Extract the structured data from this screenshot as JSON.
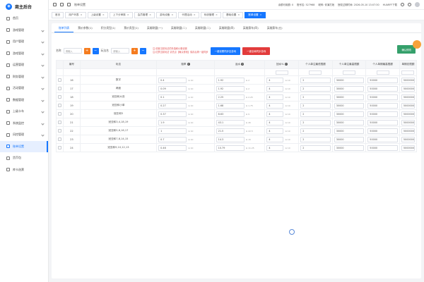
{
  "app": {
    "title": "商主后台"
  },
  "sidebar": {
    "items": [
      {
        "label": "首页",
        "active": false
      },
      {
        "label": "游戏管理",
        "active": false
      },
      {
        "label": "用户管理",
        "active": false
      },
      {
        "label": "游戏管理",
        "active": false
      },
      {
        "label": "运营管理",
        "active": false
      },
      {
        "label": "财务管理",
        "active": false
      },
      {
        "label": "活动管理",
        "active": false
      },
      {
        "label": "数据管理",
        "active": false
      },
      {
        "label": "上级卡车",
        "active": false
      },
      {
        "label": "系统监控",
        "active": false
      },
      {
        "label": "风控管理",
        "active": false
      },
      {
        "label": "账单设置",
        "active": true
      },
      {
        "label": "货币包",
        "active": false
      },
      {
        "label": "库卡选票",
        "active": false
      }
    ]
  },
  "topbar": {
    "breadcrumb": "账单设置",
    "info1": "余额可用额: 0",
    "info2": "账号名: 527968",
    "info3": "昵称: 你演打她",
    "info4": "授权过期时间: 2026-05-10 13:07:30",
    "info5": "HUARFF下载"
  },
  "tags": [
    {
      "label": "首页",
      "active": false
    },
    {
      "label": "用户列表",
      "active": false
    },
    {
      "label": "上级设置",
      "active": false
    },
    {
      "label": "上下分审核",
      "active": false
    },
    {
      "label": "会员管理",
      "active": false
    },
    {
      "label": "游戏设备",
      "active": false
    },
    {
      "label": "代理活动",
      "active": false
    },
    {
      "label": "系统管理",
      "active": false
    },
    {
      "label": "基础设置",
      "active": false
    },
    {
      "label": "账单设置",
      "active": true
    }
  ],
  "subtabs": [
    {
      "label": "账单列表",
      "active": true
    },
    {
      "label": "票价参数(1)",
      "active": false
    },
    {
      "label": "积分类型(1)",
      "active": false
    },
    {
      "label": "票价类型(1)",
      "active": false
    },
    {
      "label": "英雄联盟(一)",
      "active": false
    },
    {
      "label": "英雄联盟(二)",
      "active": false
    },
    {
      "label": "英雄联盟(二)",
      "active": false
    },
    {
      "label": "英雄联盟(四)",
      "active": false
    },
    {
      "label": "英雄赛车(四)",
      "active": false
    },
    {
      "label": "英雄赛车(五)",
      "active": false
    }
  ],
  "filter": {
    "label1": "名称",
    "placeholder1": "请输入",
    "label2": "玩法名",
    "placeholder2": "请输入",
    "tip1": "注:设置当前玩法的负值和价格设置",
    "tip2": "注:红票当前玩法 请先点【确认修改】保存后再一键同步",
    "btn_sync_prefix": "一键设置同步至游戏",
    "btn_sync_all": "一键全局同步游戏",
    "btn_confirm": "确认修改"
  },
  "table": {
    "headers": {
      "idx": "编号",
      "name": "玩法",
      "odds": "赔率",
      "rebate": "返水",
      "rate": "回水%",
      "single_min": "个人单注最低限额",
      "single_max": "个人单注最高限额",
      "total_max": "个人单期最高限额",
      "total": "单期总限额"
    },
    "rows": [
      {
        "id": "16",
        "name": "数字",
        "odds": "0.4",
        "odds_range": "≤ 10",
        "rebate": "1.92",
        "rebate_range": "≤ 2",
        "rate": "4",
        "rate_range": "≤ 10",
        "min": "2",
        "max": "30000",
        "tmax": "50000",
        "total": "5000000"
      },
      {
        "id": "17",
        "name": "两面",
        "odds": "0.09",
        "odds_range": "≤ 10",
        "rebate": "1.92",
        "rebate_range": "≤ 2",
        "rate": "4",
        "rate_range": "≤ 10",
        "min": "2",
        "max": "30000",
        "tmax": "50000",
        "total": "5000000"
      },
      {
        "id": "18",
        "name": "冠亚和大双",
        "odds": "0.1",
        "odds_range": "≤ 10",
        "rebate": "2.25",
        "rebate_range": "≤ 2.25",
        "rate": "4",
        "rate_range": "≤ 10",
        "min": "2",
        "max": "30000",
        "tmax": "50000",
        "total": "5000000"
      },
      {
        "id": "19",
        "name": "冠亚和小单",
        "odds": "0.27",
        "odds_range": "≤ 10",
        "rebate": "1.68",
        "rebate_range": "≤ 1.75",
        "rate": "4",
        "rate_range": "≤ 10",
        "min": "2",
        "max": "30000",
        "tmax": "50000",
        "total": "5000000"
      },
      {
        "id": "20",
        "name": "冠亚和3",
        "odds": "0.37",
        "odds_range": "≤ 10",
        "rebate": "8.63",
        "rebate_range": "≤ 9",
        "rate": "4",
        "rate_range": "≤ 10",
        "min": "2",
        "max": "30000",
        "tmax": "50000",
        "total": "5000000"
      },
      {
        "id": "21",
        "name": "冠亚和3,4,18,19",
        "odds": "1.9",
        "odds_range": "≤ 10",
        "rebate": "43.1",
        "rebate_range": "≤ 45",
        "rate": "4",
        "rate_range": "≤ 10",
        "min": "2",
        "max": "30000",
        "tmax": "50000",
        "total": "5000000"
      },
      {
        "id": "22",
        "name": "冠亚和5,6,16,17",
        "odds": "1",
        "odds_range": "≤ 10",
        "rebate": "21.5",
        "rebate_range": "≤ 22.5",
        "rate": "4",
        "rate_range": "≤ 10",
        "min": "2",
        "max": "30000",
        "tmax": "50000",
        "total": "5000000"
      },
      {
        "id": "23",
        "name": "冠亚和7,8,14,15",
        "odds": "0.7",
        "odds_range": "≤ 10",
        "rebate": "14.3",
        "rebate_range": "≤ 15",
        "rate": "4",
        "rate_range": "≤ 10",
        "min": "2",
        "max": "30000",
        "tmax": "50000",
        "total": "5000000"
      },
      {
        "id": "24",
        "name": "冠亚和9,10,12,13",
        "odds": "0.46",
        "odds_range": "≤ 10",
        "rebate": "10.79",
        "rebate_range": "≤ 11.25",
        "rate": "4",
        "rate_range": "≤ 10",
        "min": "2",
        "max": "30000",
        "tmax": "50000",
        "total": "5000000"
      }
    ]
  }
}
